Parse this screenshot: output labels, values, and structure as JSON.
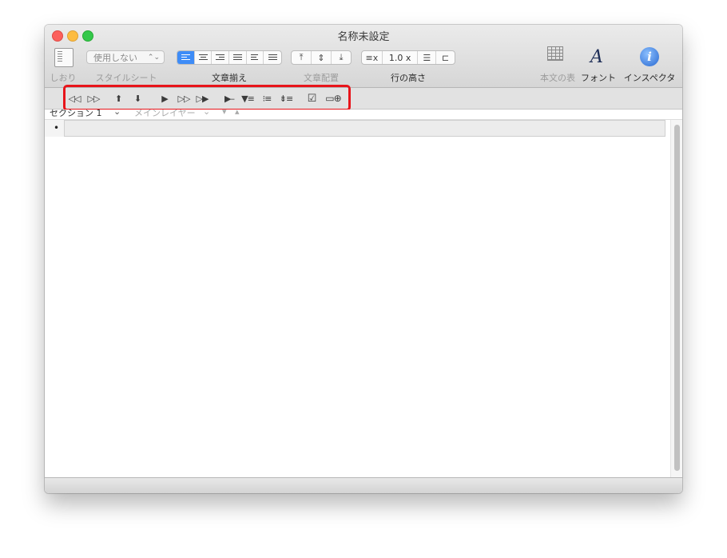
{
  "window": {
    "title": "名称未設定"
  },
  "toolbar": {
    "bookmark_label": "しおり",
    "stylesheet_label": "スタイルシート",
    "style_popup_value": "使用しない",
    "alignment_label": "文章揃え",
    "text_placement_label": "文章配置",
    "line_height_label": "行の高さ",
    "line_height_value": "1.0 x",
    "table_label": "本文の表",
    "font_label": "フォント",
    "inspector_label": "インスペクタ",
    "font_icon_glyph": "A",
    "info_icon_glyph": "i"
  },
  "format_bar": {
    "buttons": [
      {
        "name": "move-left",
        "glyph": "◁◁"
      },
      {
        "name": "move-right",
        "glyph": "▷▷"
      },
      {
        "name": "move-up",
        "glyph": "⬆"
      },
      {
        "name": "move-down",
        "glyph": "⬇"
      },
      {
        "name": "add-child",
        "glyph": "▶"
      },
      {
        "name": "add-sibling",
        "glyph": "▷▷"
      },
      {
        "name": "add-parent",
        "glyph": "▷▶"
      },
      {
        "name": "collapse",
        "glyph": "▶–"
      },
      {
        "name": "expand-list",
        "glyph": "▼≡"
      },
      {
        "name": "show-list",
        "glyph": "⁝≡"
      },
      {
        "name": "expand-all",
        "glyph": "⇟≡"
      },
      {
        "name": "checkbox",
        "glyph": "☑"
      },
      {
        "name": "add-note",
        "glyph": "▭⊕"
      }
    ]
  },
  "section_bar": {
    "section_label": "セクション 1",
    "layer_label": "メインレイヤー"
  },
  "document": {
    "bullet": "•"
  },
  "colors": {
    "highlight": "#e8141a",
    "accent": "#3e8cf7",
    "close": "#fc605c",
    "minimize": "#fdbc40",
    "zoom": "#34c84a"
  }
}
